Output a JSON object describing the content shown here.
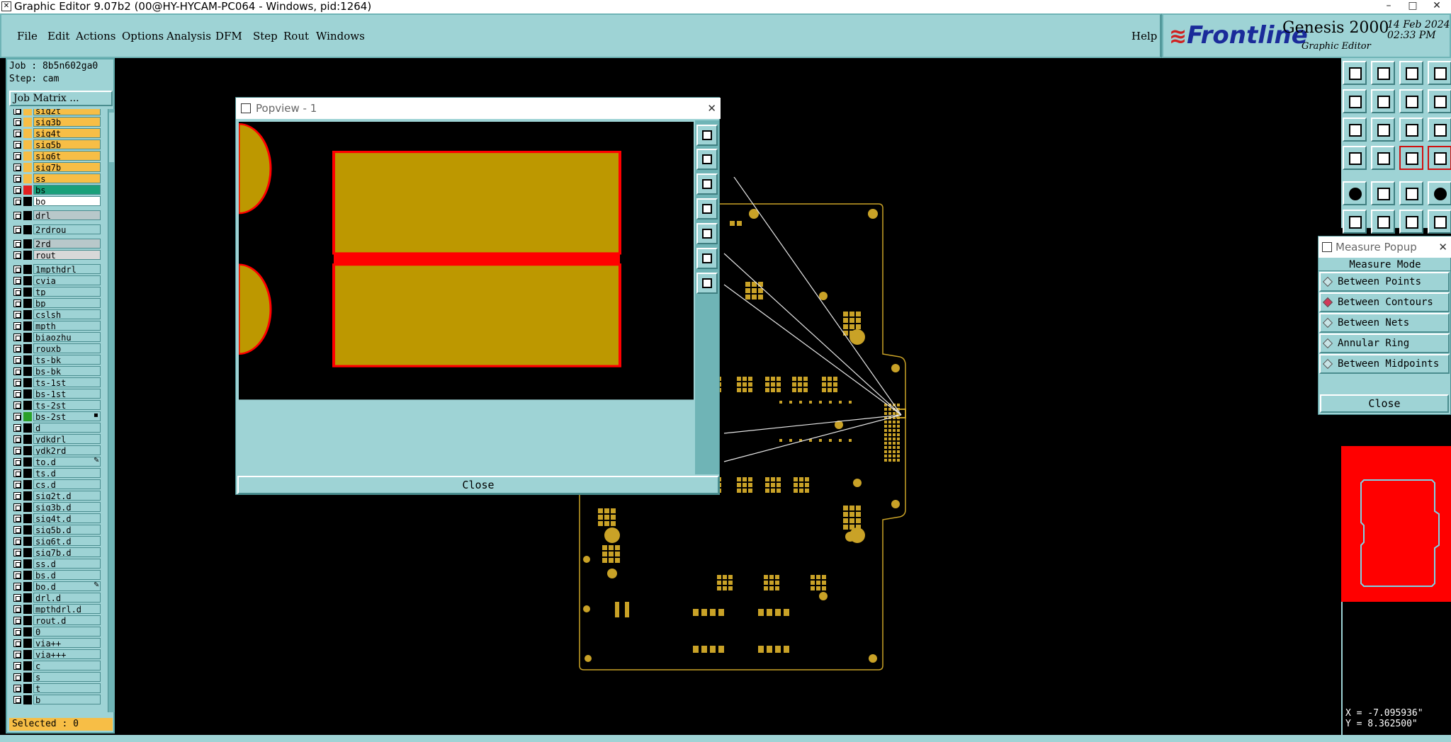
{
  "titlebar": {
    "title": "Graphic Editor 9.07b2 (00@HY-HYCAM-PC064 - Windows, pid:1264)",
    "minimize": "–",
    "maximize": "□",
    "close": "✕"
  },
  "menu": {
    "items": [
      "File",
      "Edit",
      "Actions",
      "Options",
      "Analysis",
      "DFM",
      "Step",
      "Rout",
      "Windows"
    ],
    "help": "Help"
  },
  "banner": {
    "logo": "Frontline",
    "product": "Genesis 2000",
    "subtitle": "Graphic Editor",
    "date": "14 Feb 2024",
    "time": "02:33 PM"
  },
  "job": {
    "job_line": "Job : 8b5n602ga0",
    "step_line": "Step: cam",
    "matrix_button": "Job Matrix ..."
  },
  "layers": [
    {
      "name": "sig2t",
      "color": "#f7be46",
      "fill": "#f7be46"
    },
    {
      "name": "sig3b",
      "color": "#f7be46",
      "fill": "#f7be46"
    },
    {
      "name": "sig4t",
      "color": "#f7be46",
      "fill": "#f7be46"
    },
    {
      "name": "sig5b",
      "color": "#f7be46",
      "fill": "#f7be46"
    },
    {
      "name": "sig6t",
      "color": "#f7be46",
      "fill": "#f7be46"
    },
    {
      "name": "sig7b",
      "color": "#f7be46",
      "fill": "#f7be46"
    },
    {
      "name": "ss",
      "color": "#f7be46",
      "fill": "#f7be46"
    },
    {
      "name": "bs",
      "color": "#e02020",
      "fill": "#1aa07a"
    },
    {
      "name": "bo",
      "color": "#000",
      "fill": "#ffffff"
    },
    {
      "name": "drl",
      "color": "#000",
      "fill": "#b8c8ca",
      "gap": true
    },
    {
      "name": "2rdrou",
      "color": "#000",
      "fill": "#9ed3d5",
      "gap": true
    },
    {
      "name": "2rd",
      "color": "#000",
      "fill": "#b8c8ca",
      "gap": true
    },
    {
      "name": "rout",
      "color": "#000",
      "fill": "#d8d8d8"
    },
    {
      "name": "1mpthdrl",
      "color": "#000",
      "fill": "#9ed3d5",
      "gap": true
    },
    {
      "name": "cvia",
      "color": "#000",
      "fill": "#9ed3d5"
    },
    {
      "name": "tp",
      "color": "#000",
      "fill": "#9ed3d5"
    },
    {
      "name": "bp",
      "color": "#000",
      "fill": "#9ed3d5"
    },
    {
      "name": "cslsh",
      "color": "#000",
      "fill": "#9ed3d5"
    },
    {
      "name": "mpth",
      "color": "#000",
      "fill": "#9ed3d5"
    },
    {
      "name": "biaozhu",
      "color": "#000",
      "fill": "#9ed3d5"
    },
    {
      "name": "rouxb",
      "color": "#000",
      "fill": "#9ed3d5"
    },
    {
      "name": "ts-bk",
      "color": "#000",
      "fill": "#9ed3d5"
    },
    {
      "name": "bs-bk",
      "color": "#000",
      "fill": "#9ed3d5"
    },
    {
      "name": "ts-1st",
      "color": "#000",
      "fill": "#9ed3d5"
    },
    {
      "name": "bs-1st",
      "color": "#000",
      "fill": "#9ed3d5"
    },
    {
      "name": "ts-2st",
      "color": "#000",
      "fill": "#9ed3d5"
    },
    {
      "name": "bs-2st",
      "color": "#2aa02a",
      "fill": "#9ed3d5",
      "mark": "▪"
    },
    {
      "name": "d",
      "color": "#000",
      "fill": "#9ed3d5"
    },
    {
      "name": "ydkdrl",
      "color": "#000",
      "fill": "#9ed3d5"
    },
    {
      "name": "ydk2rd",
      "color": "#000",
      "fill": "#9ed3d5"
    },
    {
      "name": "to.d",
      "color": "#000",
      "fill": "#9ed3d5",
      "mark": "✎"
    },
    {
      "name": "ts.d",
      "color": "#000",
      "fill": "#9ed3d5"
    },
    {
      "name": "cs.d",
      "color": "#000",
      "fill": "#9ed3d5"
    },
    {
      "name": "sig2t.d",
      "color": "#000",
      "fill": "#9ed3d5"
    },
    {
      "name": "sig3b.d",
      "color": "#000",
      "fill": "#9ed3d5"
    },
    {
      "name": "sig4t.d",
      "color": "#000",
      "fill": "#9ed3d5"
    },
    {
      "name": "sig5b.d",
      "color": "#000",
      "fill": "#9ed3d5"
    },
    {
      "name": "sig6t.d",
      "color": "#000",
      "fill": "#9ed3d5"
    },
    {
      "name": "sig7b.d",
      "color": "#000",
      "fill": "#9ed3d5"
    },
    {
      "name": "ss.d",
      "color": "#000",
      "fill": "#9ed3d5"
    },
    {
      "name": "bs.d",
      "color": "#000",
      "fill": "#9ed3d5"
    },
    {
      "name": "bo.d",
      "color": "#000",
      "fill": "#9ed3d5",
      "mark": "✎"
    },
    {
      "name": "drl.d",
      "color": "#000",
      "fill": "#9ed3d5"
    },
    {
      "name": "mpthdrl.d",
      "color": "#000",
      "fill": "#9ed3d5"
    },
    {
      "name": "rout.d",
      "color": "#000",
      "fill": "#9ed3d5"
    },
    {
      "name": "0",
      "color": "#000",
      "fill": "#9ed3d5"
    },
    {
      "name": "via++",
      "color": "#000",
      "fill": "#9ed3d5"
    },
    {
      "name": "via+++",
      "color": "#000",
      "fill": "#9ed3d5"
    },
    {
      "name": "c",
      "color": "#000",
      "fill": "#9ed3d5"
    },
    {
      "name": "s",
      "color": "#000",
      "fill": "#9ed3d5"
    },
    {
      "name": "t",
      "color": "#000",
      "fill": "#9ed3d5"
    },
    {
      "name": "b",
      "color": "#000",
      "fill": "#9ed3d5"
    }
  ],
  "status": {
    "selected": "Selected : 0"
  },
  "popview": {
    "title": "Popview - 1",
    "close": "✕",
    "close_button": "Close",
    "pad_color": "#bd9800",
    "outline_color": "#ff0000"
  },
  "measure": {
    "title": "Measure Popup",
    "close": "✕",
    "mode_label": "Measure Mode",
    "options": [
      {
        "label": "Between Points",
        "selected": false
      },
      {
        "label": "Between Contours",
        "selected": true
      },
      {
        "label": "Between Nets",
        "selected": false
      },
      {
        "label": "Annular Ring",
        "selected": false
      },
      {
        "label": "Between Midpoints",
        "selected": false
      }
    ],
    "close_button": "Close"
  },
  "coords": {
    "x": "X = -7.095936\"",
    "y": "Y = 8.362500\""
  },
  "colors": {
    "panel": "#9ed3d5",
    "accent": "#f7be46",
    "copper": "#c9a227",
    "minimap": "#ff0000"
  }
}
